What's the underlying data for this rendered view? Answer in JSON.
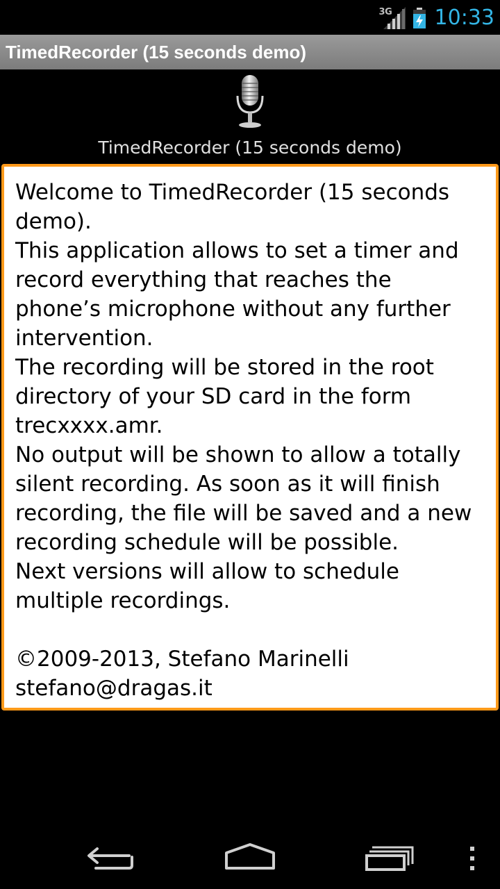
{
  "status_bar": {
    "network_type": "3G",
    "time": "10:33",
    "icons": [
      "signal-icon",
      "battery-charging-icon"
    ]
  },
  "title_bar": {
    "title": "TimedRecorder (15 seconds demo)"
  },
  "header": {
    "icon": "microphone-icon",
    "subtitle": "TimedRecorder (15 seconds demo)"
  },
  "info": {
    "text": "Welcome to TimedRecorder (15 seconds\ndemo).\nThis application allows to set a timer and\nrecord everything that reaches the\nphone’s microphone without any further\nintervention.\nThe recording will be stored in the root\ndirectory of your SD card in the form\ntrecxxxx.amr.\nNo output will be shown to allow a totally\nsilent recording. As soon as it will finish\nrecording, the file will be saved and a new\nrecording schedule will be possible.\nNext versions will allow to schedule\nmultiple recordings.\n\n©2009-2013, Stefano Marinelli\nstefano@dragas.it"
  },
  "nav_bar": {
    "icons": [
      "back-icon",
      "home-icon",
      "recent-apps-icon",
      "menu-icon"
    ]
  },
  "colors": {
    "accent_clock": "#33b5e5",
    "box_border": "#ff9a1a",
    "title_bar": "#8a8a8a"
  }
}
